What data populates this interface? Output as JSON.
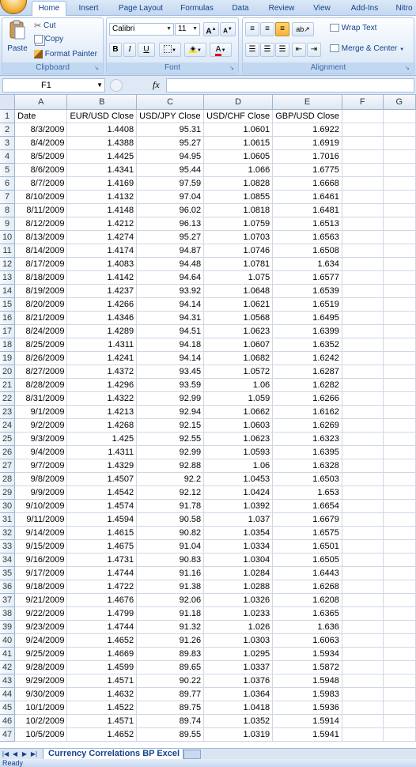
{
  "ribbon_tabs": [
    "Home",
    "Insert",
    "Page Layout",
    "Formulas",
    "Data",
    "Review",
    "View",
    "Add-Ins",
    "Nitro"
  ],
  "clipboard": {
    "paste": "Paste",
    "cut": "Cut",
    "copy": "Copy",
    "format_painter": "Format Painter",
    "label": "Clipboard"
  },
  "font": {
    "name": "Calibri",
    "size": "11",
    "label": "Font",
    "bold": "B",
    "italic": "I",
    "underline": "U",
    "grow": "A",
    "shrink": "A",
    "font_color": "A"
  },
  "alignment": {
    "wrap_text": "Wrap Text",
    "merge_center": "Merge & Center",
    "label": "Alignment"
  },
  "formula_bar": {
    "cell_ref": "F1",
    "fx": "fx",
    "content": ""
  },
  "columns": [
    "A",
    "B",
    "C",
    "D",
    "E",
    "F",
    "G"
  ],
  "headers": [
    "Date",
    "EUR/USD Close",
    "USD/JPY Close",
    "USD/CHF Close",
    "GBP/USD Close"
  ],
  "rows": [
    [
      "8/3/2009",
      "1.4408",
      "95.31",
      "1.0601",
      "1.6922"
    ],
    [
      "8/4/2009",
      "1.4388",
      "95.27",
      "1.0615",
      "1.6919"
    ],
    [
      "8/5/2009",
      "1.4425",
      "94.95",
      "1.0605",
      "1.7016"
    ],
    [
      "8/6/2009",
      "1.4341",
      "95.44",
      "1.066",
      "1.6775"
    ],
    [
      "8/7/2009",
      "1.4169",
      "97.59",
      "1.0828",
      "1.6668"
    ],
    [
      "8/10/2009",
      "1.4132",
      "97.04",
      "1.0855",
      "1.6461"
    ],
    [
      "8/11/2009",
      "1.4148",
      "96.02",
      "1.0818",
      "1.6481"
    ],
    [
      "8/12/2009",
      "1.4212",
      "96.13",
      "1.0759",
      "1.6513"
    ],
    [
      "8/13/2009",
      "1.4274",
      "95.27",
      "1.0703",
      "1.6563"
    ],
    [
      "8/14/2009",
      "1.4174",
      "94.87",
      "1.0746",
      "1.6508"
    ],
    [
      "8/17/2009",
      "1.4083",
      "94.48",
      "1.0781",
      "1.634"
    ],
    [
      "8/18/2009",
      "1.4142",
      "94.64",
      "1.075",
      "1.6577"
    ],
    [
      "8/19/2009",
      "1.4237",
      "93.92",
      "1.0648",
      "1.6539"
    ],
    [
      "8/20/2009",
      "1.4266",
      "94.14",
      "1.0621",
      "1.6519"
    ],
    [
      "8/21/2009",
      "1.4346",
      "94.31",
      "1.0568",
      "1.6495"
    ],
    [
      "8/24/2009",
      "1.4289",
      "94.51",
      "1.0623",
      "1.6399"
    ],
    [
      "8/25/2009",
      "1.4311",
      "94.18",
      "1.0607",
      "1.6352"
    ],
    [
      "8/26/2009",
      "1.4241",
      "94.14",
      "1.0682",
      "1.6242"
    ],
    [
      "8/27/2009",
      "1.4372",
      "93.45",
      "1.0572",
      "1.6287"
    ],
    [
      "8/28/2009",
      "1.4296",
      "93.59",
      "1.06",
      "1.6282"
    ],
    [
      "8/31/2009",
      "1.4322",
      "92.99",
      "1.059",
      "1.6266"
    ],
    [
      "9/1/2009",
      "1.4213",
      "92.94",
      "1.0662",
      "1.6162"
    ],
    [
      "9/2/2009",
      "1.4268",
      "92.15",
      "1.0603",
      "1.6269"
    ],
    [
      "9/3/2009",
      "1.425",
      "92.55",
      "1.0623",
      "1.6323"
    ],
    [
      "9/4/2009",
      "1.4311",
      "92.99",
      "1.0593",
      "1.6395"
    ],
    [
      "9/7/2009",
      "1.4329",
      "92.88",
      "1.06",
      "1.6328"
    ],
    [
      "9/8/2009",
      "1.4507",
      "92.2",
      "1.0453",
      "1.6503"
    ],
    [
      "9/9/2009",
      "1.4542",
      "92.12",
      "1.0424",
      "1.653"
    ],
    [
      "9/10/2009",
      "1.4574",
      "91.78",
      "1.0392",
      "1.6654"
    ],
    [
      "9/11/2009",
      "1.4594",
      "90.58",
      "1.037",
      "1.6679"
    ],
    [
      "9/14/2009",
      "1.4615",
      "90.82",
      "1.0354",
      "1.6575"
    ],
    [
      "9/15/2009",
      "1.4675",
      "91.04",
      "1.0334",
      "1.6501"
    ],
    [
      "9/16/2009",
      "1.4731",
      "90.83",
      "1.0304",
      "1.6505"
    ],
    [
      "9/17/2009",
      "1.4744",
      "91.16",
      "1.0284",
      "1.6443"
    ],
    [
      "9/18/2009",
      "1.4722",
      "91.38",
      "1.0288",
      "1.6268"
    ],
    [
      "9/21/2009",
      "1.4676",
      "92.06",
      "1.0326",
      "1.6208"
    ],
    [
      "9/22/2009",
      "1.4799",
      "91.18",
      "1.0233",
      "1.6365"
    ],
    [
      "9/23/2009",
      "1.4744",
      "91.32",
      "1.026",
      "1.636"
    ],
    [
      "9/24/2009",
      "1.4652",
      "91.26",
      "1.0303",
      "1.6063"
    ],
    [
      "9/25/2009",
      "1.4669",
      "89.83",
      "1.0295",
      "1.5934"
    ],
    [
      "9/28/2009",
      "1.4599",
      "89.65",
      "1.0337",
      "1.5872"
    ],
    [
      "9/29/2009",
      "1.4571",
      "90.22",
      "1.0376",
      "1.5948"
    ],
    [
      "9/30/2009",
      "1.4632",
      "89.77",
      "1.0364",
      "1.5983"
    ],
    [
      "10/1/2009",
      "1.4522",
      "89.75",
      "1.0418",
      "1.5936"
    ],
    [
      "10/2/2009",
      "1.4571",
      "89.74",
      "1.0352",
      "1.5914"
    ],
    [
      "10/5/2009",
      "1.4652",
      "89.55",
      "1.0319",
      "1.5941"
    ]
  ],
  "sheet_tab": "Currency Correlations BP Excel",
  "status": "Ready",
  "colors": {
    "ribbon_text": "#15428b",
    "grid_line": "#d0d7e5",
    "header_bg": "#dde6f2"
  }
}
